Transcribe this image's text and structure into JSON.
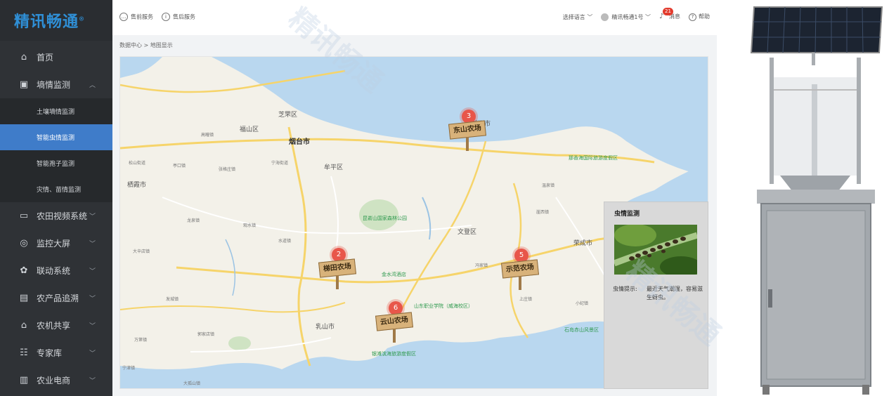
{
  "app": {
    "logo": "精讯畅通",
    "logo_mark": "®"
  },
  "topbar": {
    "presale": "售前服务",
    "aftersale": "售后服务",
    "language": "选择语言",
    "user": "精讯畅通1号",
    "message_count": "21",
    "message": "消息",
    "help": "帮助"
  },
  "sidebar": {
    "items": [
      {
        "label": "首页",
        "icon": "home-icon"
      },
      {
        "label": "墒情监测",
        "icon": "monitor-icon",
        "expanded": true
      },
      {
        "label": "农田视频系统",
        "icon": "screen-icon"
      },
      {
        "label": "监控大屏",
        "icon": "location-icon"
      },
      {
        "label": "联动系统",
        "icon": "link-icon"
      },
      {
        "label": "农产品追溯",
        "icon": "trace-icon"
      },
      {
        "label": "农机共享",
        "icon": "barn-icon"
      },
      {
        "label": "专家库",
        "icon": "expert-icon"
      },
      {
        "label": "农业电商",
        "icon": "shop-icon"
      }
    ],
    "subitems": [
      {
        "label": "土壤墒情监测"
      },
      {
        "label": "智能虫情监测",
        "active": true
      },
      {
        "label": "智能孢子监测"
      },
      {
        "label": "灾情、苗情监测"
      }
    ]
  },
  "breadcrumb": {
    "root": "数据中心",
    "sep": ">",
    "current": "地图显示"
  },
  "map": {
    "cities": [
      "芝罘区",
      "福山区",
      "烟台市",
      "牟平区",
      "威海市",
      "文登区",
      "荣成市",
      "乳山市",
      "栖霞市",
      "华新区"
    ],
    "towns": [
      "高疃镇",
      "松山街道",
      "栖霞镇",
      "亭口镇",
      "张格庄镇",
      "牟平镇",
      "宁海街道",
      "龙泉镇",
      "古现镇",
      "观水镇",
      "大辛店镇",
      "莱阳镇",
      "徐家店镇",
      "水道镇",
      "发城镇",
      "午极镇",
      "郭家店镇",
      "冯家镇",
      "万第镇",
      "上庄镇",
      "泽头镇",
      "夏村镇",
      "大孤山镇",
      "宁津镇",
      "小纪镇",
      "大疃镇",
      "崖西镇",
      "温泉镇",
      "桥头镇",
      "于家镇",
      "海阳所镇",
      "汪疃镇",
      "苗家镇"
    ],
    "parks": [
      "昆嵛山国家森林公园",
      "那香海国际旅游度假区",
      "山东职业学院（威海校区）",
      "银滩滨海旅游度假区",
      "金水湾酒店",
      "石岛赤山风景区"
    ],
    "farms": [
      {
        "num": "3",
        "name": "东山农场"
      },
      {
        "num": "2",
        "name": "梯田农场"
      },
      {
        "num": "5",
        "name": "示范农场"
      },
      {
        "num": "6",
        "name": "云山农场"
      }
    ]
  },
  "pest_panel": {
    "title": "虫情监测",
    "hint_label": "虫情提示:",
    "hint_text": "最近天气潮湿，容易滋生蚜虫。"
  },
  "watermark": "精讯畅通",
  "colors": {
    "sidebar_bg": "#2f3236",
    "active": "#3f7cc9",
    "sea": "#b9d7ef",
    "badge": "#e23b2d"
  }
}
